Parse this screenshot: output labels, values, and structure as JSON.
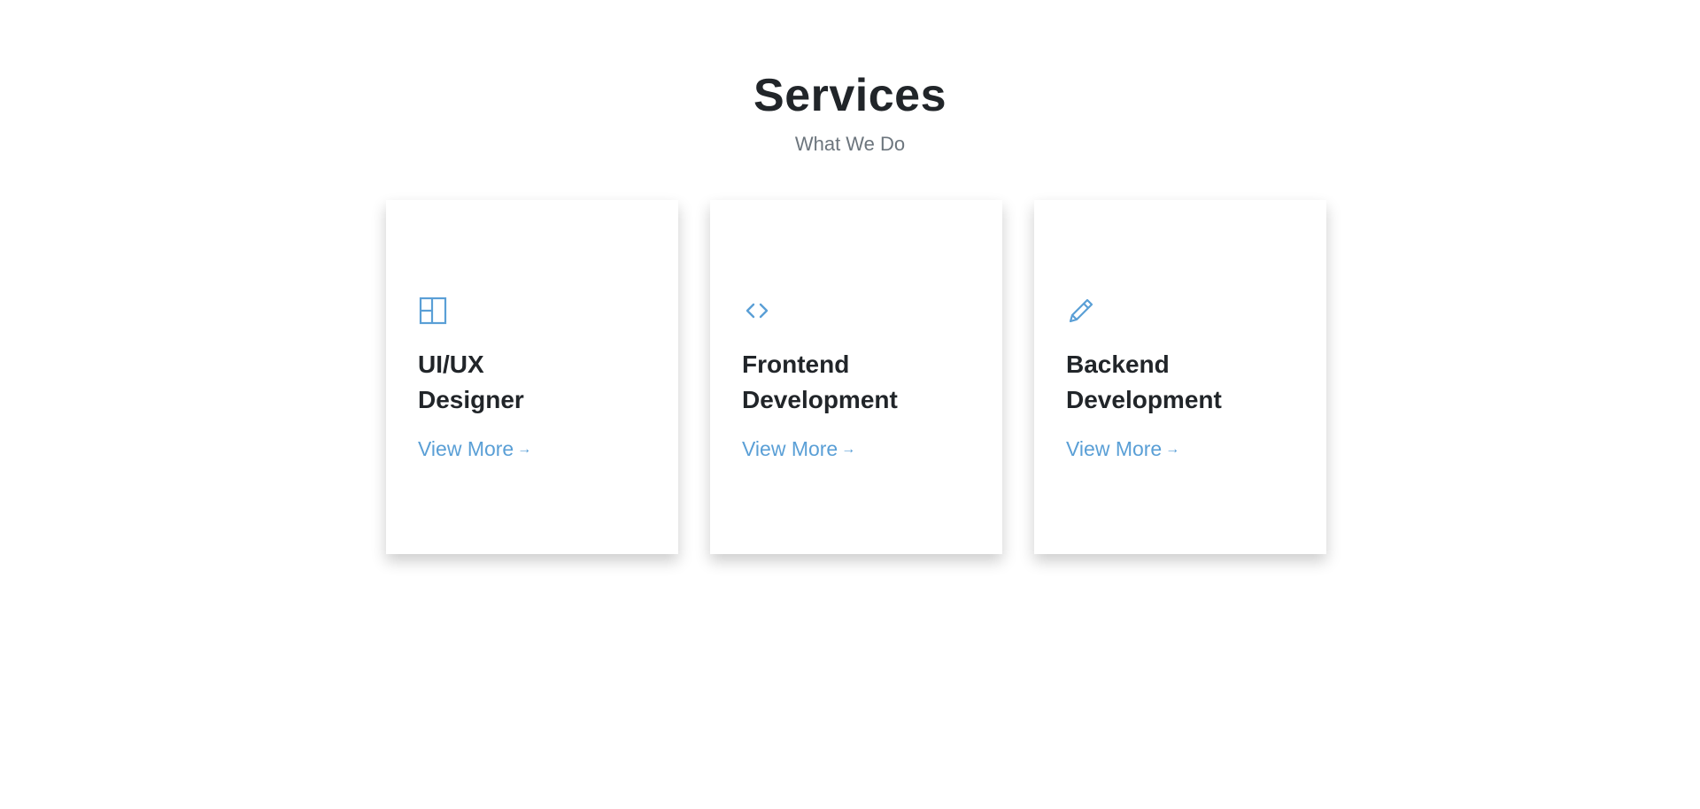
{
  "section": {
    "title": "Services",
    "subtitle": "What We Do"
  },
  "cards": [
    {
      "icon": "layout-icon",
      "title": "UI/UX Designer",
      "link_label": "View More"
    },
    {
      "icon": "code-icon",
      "title": "Frontend Development",
      "link_label": "View More"
    },
    {
      "icon": "pencil-icon",
      "title": "Backend Development",
      "link_label": "View More"
    }
  ],
  "colors": {
    "accent": "#5a9fd6",
    "title": "#212529",
    "subtitle": "#6c757d"
  }
}
